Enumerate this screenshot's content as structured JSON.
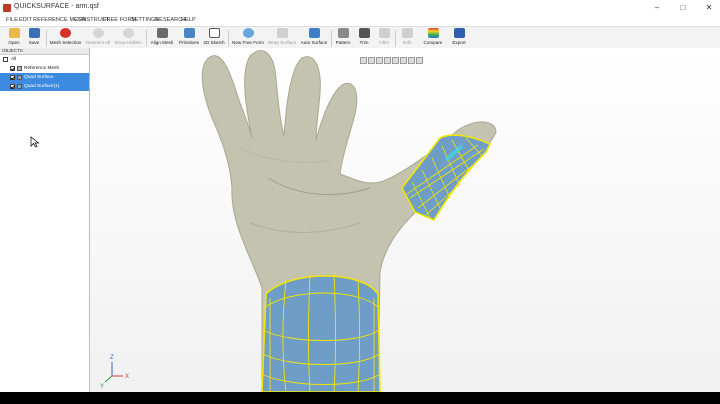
{
  "window": {
    "title": "QUICKSURFACE - arm.qsf",
    "minimize": "–",
    "maximize": "□",
    "close": "✕"
  },
  "menu": [
    "FILE",
    "EDIT",
    "REFERENCE MESH",
    "CONSTRUCT",
    "FREE FORM",
    "SETTINGS",
    "RESEARCH",
    "HELP"
  ],
  "toolbar": {
    "open": "Open",
    "save": "Save",
    "mesh_selection": "Mesh Selection",
    "deselect_all": "Deselect All",
    "show_hidden": "Show Hidden",
    "align_mesh": "Align Mesh",
    "primitives": "Primitives",
    "sketch_2d": "2D Sketch",
    "new_free_form": "New Free Form",
    "wrap_surface": "Wrap Surface",
    "auto_surface": "Auto Surface",
    "pattern": "Pattern",
    "trim": "Trim",
    "fillet": "Fillet",
    "edit": "Edit",
    "compare": "Compare",
    "export": "Export"
  },
  "objects_panel": {
    "header": "OBJECTS",
    "items": [
      "All",
      "Reference Mesh",
      "Quad Surface",
      "Quad Surface(1)"
    ]
  },
  "axis": {
    "x": "X",
    "y": "Y",
    "z": "Z"
  },
  "colors": {
    "accent": "#3d8be0",
    "mesh": "#c4c3b0",
    "surface": "#6e9ec7",
    "wire": "#f2e600"
  }
}
